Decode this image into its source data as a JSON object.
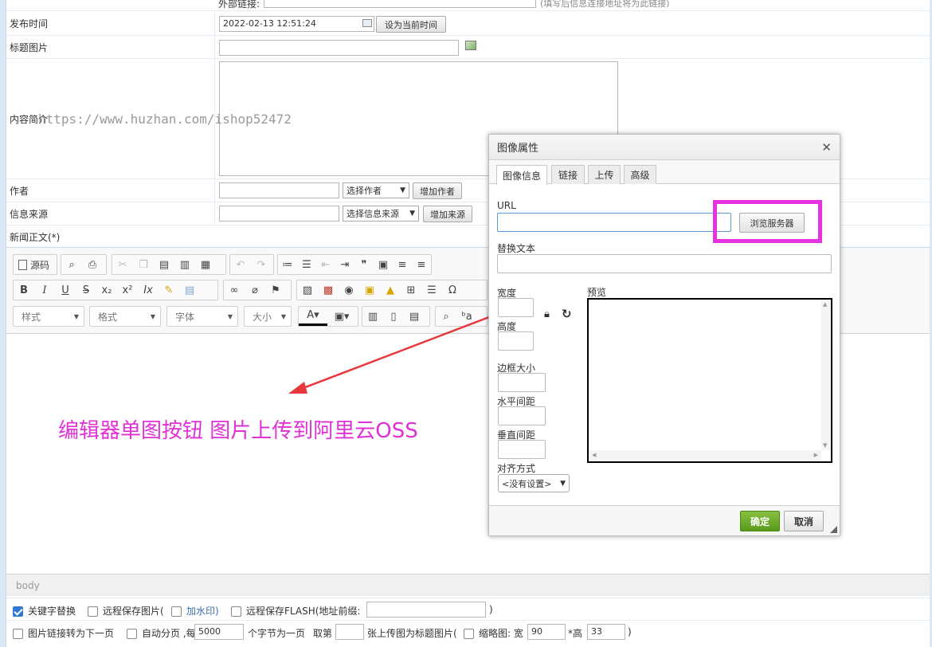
{
  "form": {
    "external_link_label": "外部链接:",
    "external_link_hint": "(填写后信息连接地址将为此链接)",
    "publish_time_label": "发布时间",
    "publish_time_value": "2022-02-13 12:51:24",
    "set_now_button": "设为当前时间",
    "title_image_label": "标题图片",
    "summary_label": "内容简介",
    "author_label": "作者",
    "author_select": "选择作者",
    "add_author_button": "增加作者",
    "source_label": "信息来源",
    "source_select": "选择信息来源",
    "add_source_button": "增加来源",
    "body_label": "新闻正文(*)"
  },
  "watermark": "https://www.huzhan.com/ishop52472",
  "editor": {
    "source_label": "源码",
    "styles_combo": "样式",
    "format_combo": "格式",
    "font_combo": "字体",
    "size_combo": "大小",
    "status_path": "body"
  },
  "annotation": "编辑器单图按钮 图片上传到阿里云OSS",
  "dialog": {
    "title": "图像属性",
    "tabs": [
      "图像信息",
      "链接",
      "上传",
      "高级"
    ],
    "url_label": "URL",
    "browse_button": "浏览服务器",
    "alt_label": "替换文本",
    "width_label": "宽度",
    "height_label": "高度",
    "border_label": "边框大小",
    "hspace_label": "水平间距",
    "vspace_label": "垂直间距",
    "align_label": "对齐方式",
    "align_value": "<没有设置>",
    "preview_label": "预览",
    "ok_button": "确定",
    "cancel_button": "取消"
  },
  "options": {
    "keyword_replace": "关键字替换",
    "remote_save_image": "远程保存图片(",
    "watermark": "加水印)",
    "remote_save_flash": "远程保存FLASH(地址前缀:",
    "flash_close": ")",
    "img_link_next": "图片链接转为下一页",
    "auto_paging": "自动分页 ,每",
    "paging_value": "5000",
    "chars_per_page": "个字节为一页",
    "take_nth": "取第",
    "uploaded_as_title": "张上传图为标题图片(",
    "thumbnail": "缩略图: 宽",
    "thumb_width": "90",
    "height_mark": "*高",
    "thumb_height": "33",
    "close_paren": ")"
  },
  "colors": {
    "accent_pink": "#e031d6",
    "ok_green": "#6aa520",
    "arrow_red": "#e8383d",
    "checkbox_blue": "#3478d6"
  }
}
